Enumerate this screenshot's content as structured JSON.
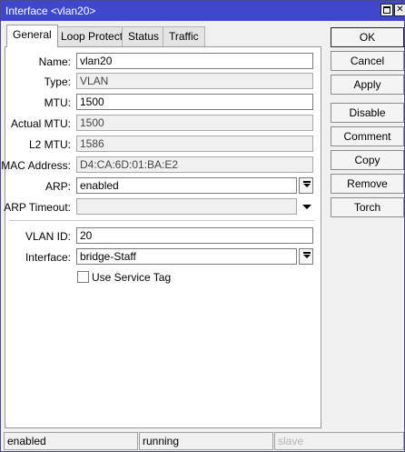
{
  "window": {
    "title": "Interface <vlan20>"
  },
  "tabs": [
    {
      "label": "General"
    },
    {
      "label": "Loop Protect"
    },
    {
      "label": "Status"
    },
    {
      "label": "Traffic"
    }
  ],
  "form": {
    "name": {
      "label": "Name:",
      "value": "vlan20"
    },
    "type": {
      "label": "Type:",
      "value": "VLAN"
    },
    "mtu": {
      "label": "MTU:",
      "value": "1500"
    },
    "actual_mtu": {
      "label": "Actual MTU:",
      "value": "1500"
    },
    "l2_mtu": {
      "label": "L2 MTU:",
      "value": "1586"
    },
    "mac_address": {
      "label": "MAC Address:",
      "value": "D4:CA:6D:01:BA:E2"
    },
    "arp": {
      "label": "ARP:",
      "value": "enabled"
    },
    "arp_timeout": {
      "label": "ARP Timeout:",
      "value": ""
    },
    "vlan_id": {
      "label": "VLAN ID:",
      "value": "20"
    },
    "interface": {
      "label": "Interface:",
      "value": "bridge-Staff"
    },
    "use_service_tag": {
      "label": "Use Service Tag",
      "checked": false
    }
  },
  "buttons": [
    {
      "label": "OK"
    },
    {
      "label": "Cancel"
    },
    {
      "label": "Apply"
    },
    {
      "label": "Disable"
    },
    {
      "label": "Comment"
    },
    {
      "label": "Copy"
    },
    {
      "label": "Remove"
    },
    {
      "label": "Torch"
    }
  ],
  "status": {
    "state": "enabled",
    "running": "running",
    "slave": "slave"
  }
}
